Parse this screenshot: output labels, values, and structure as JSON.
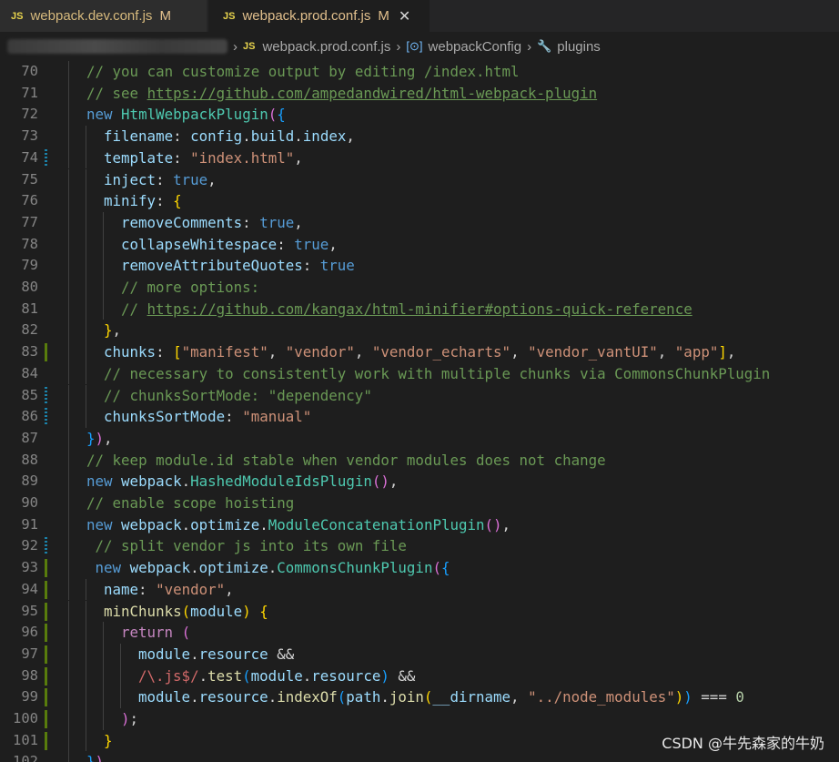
{
  "tabs": [
    {
      "badge": "JS",
      "label": "webpack.dev.conf.js",
      "status": "M"
    },
    {
      "badge": "JS",
      "label": "webpack.prod.conf.js",
      "status": "M",
      "close": "✕"
    }
  ],
  "breadcrumb": {
    "file_badge": "JS",
    "file": "webpack.prod.conf.js",
    "symbol_icon": "[⊙]",
    "symbol": "webpackConfig",
    "property_icon": "🔧",
    "property": "plugins"
  },
  "gutter_changes": {
    "74": "chg",
    "83": "add",
    "85": "chg",
    "86": "chg",
    "92": "chg",
    "93": "add",
    "94": "add",
    "95": "add",
    "96": "add",
    "97": "add",
    "98": "add",
    "99": "add",
    "100": "add",
    "101": "add"
  },
  "code_lines": [
    {
      "n": "70",
      "indent": 1,
      "tokens": [
        [
          "c",
          "// you can customize output by editing /index.html"
        ]
      ]
    },
    {
      "n": "71",
      "indent": 1,
      "tokens": [
        [
          "c",
          "// see "
        ],
        [
          "c u",
          "https://github.com/ampedandwired/html-webpack-plugin"
        ]
      ]
    },
    {
      "n": "72",
      "indent": 1,
      "tokens": [
        [
          "k",
          "new "
        ],
        [
          "cl",
          "HtmlWebpackPlugin"
        ],
        [
          "b2",
          "("
        ],
        [
          "b3",
          "{"
        ]
      ]
    },
    {
      "n": "73",
      "indent": 2,
      "tokens": [
        [
          "p",
          "filename"
        ],
        [
          "o",
          ": "
        ],
        [
          "p",
          "config"
        ],
        [
          "o",
          "."
        ],
        [
          "p",
          "build"
        ],
        [
          "o",
          "."
        ],
        [
          "p",
          "index"
        ],
        [
          "o",
          ","
        ]
      ]
    },
    {
      "n": "74",
      "indent": 2,
      "tokens": [
        [
          "p",
          "template"
        ],
        [
          "o",
          ": "
        ],
        [
          "s",
          "\"index.html\""
        ],
        [
          "o",
          ","
        ]
      ]
    },
    {
      "n": "75",
      "indent": 2,
      "tokens": [
        [
          "p",
          "inject"
        ],
        [
          "o",
          ": "
        ],
        [
          "k",
          "true"
        ],
        [
          "o",
          ","
        ]
      ]
    },
    {
      "n": "76",
      "indent": 2,
      "tokens": [
        [
          "p",
          "minify"
        ],
        [
          "o",
          ": "
        ],
        [
          "b1",
          "{"
        ]
      ]
    },
    {
      "n": "77",
      "indent": 3,
      "tokens": [
        [
          "p",
          "removeComments"
        ],
        [
          "o",
          ": "
        ],
        [
          "k",
          "true"
        ],
        [
          "o",
          ","
        ]
      ]
    },
    {
      "n": "78",
      "indent": 3,
      "tokens": [
        [
          "p",
          "collapseWhitespace"
        ],
        [
          "o",
          ": "
        ],
        [
          "k",
          "true"
        ],
        [
          "o",
          ","
        ]
      ]
    },
    {
      "n": "79",
      "indent": 3,
      "tokens": [
        [
          "p",
          "removeAttributeQuotes"
        ],
        [
          "o",
          ": "
        ],
        [
          "k",
          "true"
        ]
      ]
    },
    {
      "n": "80",
      "indent": 3,
      "tokens": [
        [
          "c",
          "// more options:"
        ]
      ]
    },
    {
      "n": "81",
      "indent": 3,
      "tokens": [
        [
          "c",
          "// "
        ],
        [
          "c u",
          "https://github.com/kangax/html-minifier#options-quick-reference"
        ]
      ]
    },
    {
      "n": "82",
      "indent": 2,
      "tokens": [
        [
          "b1",
          "}"
        ],
        [
          "o",
          ","
        ]
      ]
    },
    {
      "n": "83",
      "indent": 2,
      "tokens": [
        [
          "p",
          "chunks"
        ],
        [
          "o",
          ": "
        ],
        [
          "b1",
          "["
        ],
        [
          "s",
          "\"manifest\""
        ],
        [
          "o",
          ", "
        ],
        [
          "s",
          "\"vendor\""
        ],
        [
          "o",
          ", "
        ],
        [
          "s",
          "\"vendor_echarts\""
        ],
        [
          "o",
          ", "
        ],
        [
          "s",
          "\"vendor_vantUI\""
        ],
        [
          "o",
          ", "
        ],
        [
          "s",
          "\"app\""
        ],
        [
          "b1",
          "]"
        ],
        [
          "o",
          ","
        ]
      ]
    },
    {
      "n": "84",
      "indent": 2,
      "tokens": [
        [
          "c",
          "// necessary to consistently work with multiple chunks via CommonsChunkPlugin"
        ]
      ]
    },
    {
      "n": "85",
      "indent": 2,
      "tokens": [
        [
          "c",
          "// chunksSortMode: \"dependency\""
        ]
      ]
    },
    {
      "n": "86",
      "indent": 2,
      "tokens": [
        [
          "p",
          "chunksSortMode"
        ],
        [
          "o",
          ": "
        ],
        [
          "s",
          "\"manual\""
        ]
      ]
    },
    {
      "n": "87",
      "indent": 1,
      "tokens": [
        [
          "b3",
          "}"
        ],
        [
          "b2",
          ")"
        ],
        [
          "o",
          ","
        ]
      ]
    },
    {
      "n": "88",
      "indent": 1,
      "tokens": [
        [
          "c",
          "// keep module.id stable when vendor modules does not change"
        ]
      ]
    },
    {
      "n": "89",
      "indent": 1,
      "tokens": [
        [
          "k",
          "new "
        ],
        [
          "p",
          "webpack"
        ],
        [
          "o",
          "."
        ],
        [
          "cl",
          "HashedModuleIdsPlugin"
        ],
        [
          "b2",
          "()"
        ],
        [
          "o",
          ","
        ]
      ]
    },
    {
      "n": "90",
      "indent": 1,
      "tokens": [
        [
          "c",
          "// enable scope hoisting"
        ]
      ]
    },
    {
      "n": "91",
      "indent": 1,
      "tokens": [
        [
          "k",
          "new "
        ],
        [
          "p",
          "webpack"
        ],
        [
          "o",
          "."
        ],
        [
          "p",
          "optimize"
        ],
        [
          "o",
          "."
        ],
        [
          "cl",
          "ModuleConcatenationPlugin"
        ],
        [
          "b2",
          "()"
        ],
        [
          "o",
          ","
        ]
      ]
    },
    {
      "n": "92",
      "indent": 1,
      "tokens": [
        [
          "o",
          " "
        ],
        [
          "c",
          "// split vendor js into its own file"
        ]
      ]
    },
    {
      "n": "93",
      "indent": 1,
      "tokens": [
        [
          "o",
          " "
        ],
        [
          "k",
          "new "
        ],
        [
          "p",
          "webpack"
        ],
        [
          "o",
          "."
        ],
        [
          "p",
          "optimize"
        ],
        [
          "o",
          "."
        ],
        [
          "cl",
          "CommonsChunkPlugin"
        ],
        [
          "b2",
          "("
        ],
        [
          "b3",
          "{"
        ]
      ]
    },
    {
      "n": "94",
      "indent": 2,
      "tokens": [
        [
          "p",
          "name"
        ],
        [
          "o",
          ": "
        ],
        [
          "s",
          "\"vendor\""
        ],
        [
          "o",
          ","
        ]
      ]
    },
    {
      "n": "95",
      "indent": 2,
      "tokens": [
        [
          "f",
          "minChunks"
        ],
        [
          "b1",
          "("
        ],
        [
          "p",
          "module"
        ],
        [
          "b1",
          ")"
        ],
        [
          "o",
          " "
        ],
        [
          "b1",
          "{"
        ]
      ]
    },
    {
      "n": "96",
      "indent": 3,
      "tokens": [
        [
          "kc",
          "return "
        ],
        [
          "b2",
          "("
        ]
      ]
    },
    {
      "n": "97",
      "indent": 4,
      "tokens": [
        [
          "p",
          "module"
        ],
        [
          "o",
          "."
        ],
        [
          "p",
          "resource"
        ],
        [
          "o",
          " &&"
        ]
      ]
    },
    {
      "n": "98",
      "indent": 4,
      "tokens": [
        [
          "rx",
          "/\\.js$/"
        ],
        [
          "o",
          "."
        ],
        [
          "f",
          "test"
        ],
        [
          "b3",
          "("
        ],
        [
          "p",
          "module"
        ],
        [
          "o",
          "."
        ],
        [
          "p",
          "resource"
        ],
        [
          "b3",
          ")"
        ],
        [
          "o",
          " &&"
        ]
      ]
    },
    {
      "n": "99",
      "indent": 4,
      "tokens": [
        [
          "p",
          "module"
        ],
        [
          "o",
          "."
        ],
        [
          "p",
          "resource"
        ],
        [
          "o",
          "."
        ],
        [
          "f",
          "indexOf"
        ],
        [
          "b3",
          "("
        ],
        [
          "p",
          "path"
        ],
        [
          "o",
          "."
        ],
        [
          "f",
          "join"
        ],
        [
          "b1",
          "("
        ],
        [
          "p",
          "__dirname"
        ],
        [
          "o",
          ", "
        ],
        [
          "s",
          "\"../node_modules\""
        ],
        [
          "b1",
          ")"
        ],
        [
          "b3",
          ")"
        ],
        [
          "o",
          " === "
        ],
        [
          "n",
          "0"
        ]
      ]
    },
    {
      "n": "100",
      "indent": 3,
      "tokens": [
        [
          "b2",
          ")"
        ],
        [
          "o",
          ";"
        ]
      ]
    },
    {
      "n": "101",
      "indent": 2,
      "tokens": [
        [
          "b1",
          "}"
        ]
      ]
    },
    {
      "n": "102",
      "indent": 1,
      "tokens": [
        [
          "b3",
          "}"
        ],
        [
          "b2",
          ")"
        ],
        [
          "o",
          ","
        ]
      ]
    }
  ],
  "watermark": "CSDN @牛先森家的牛奶"
}
